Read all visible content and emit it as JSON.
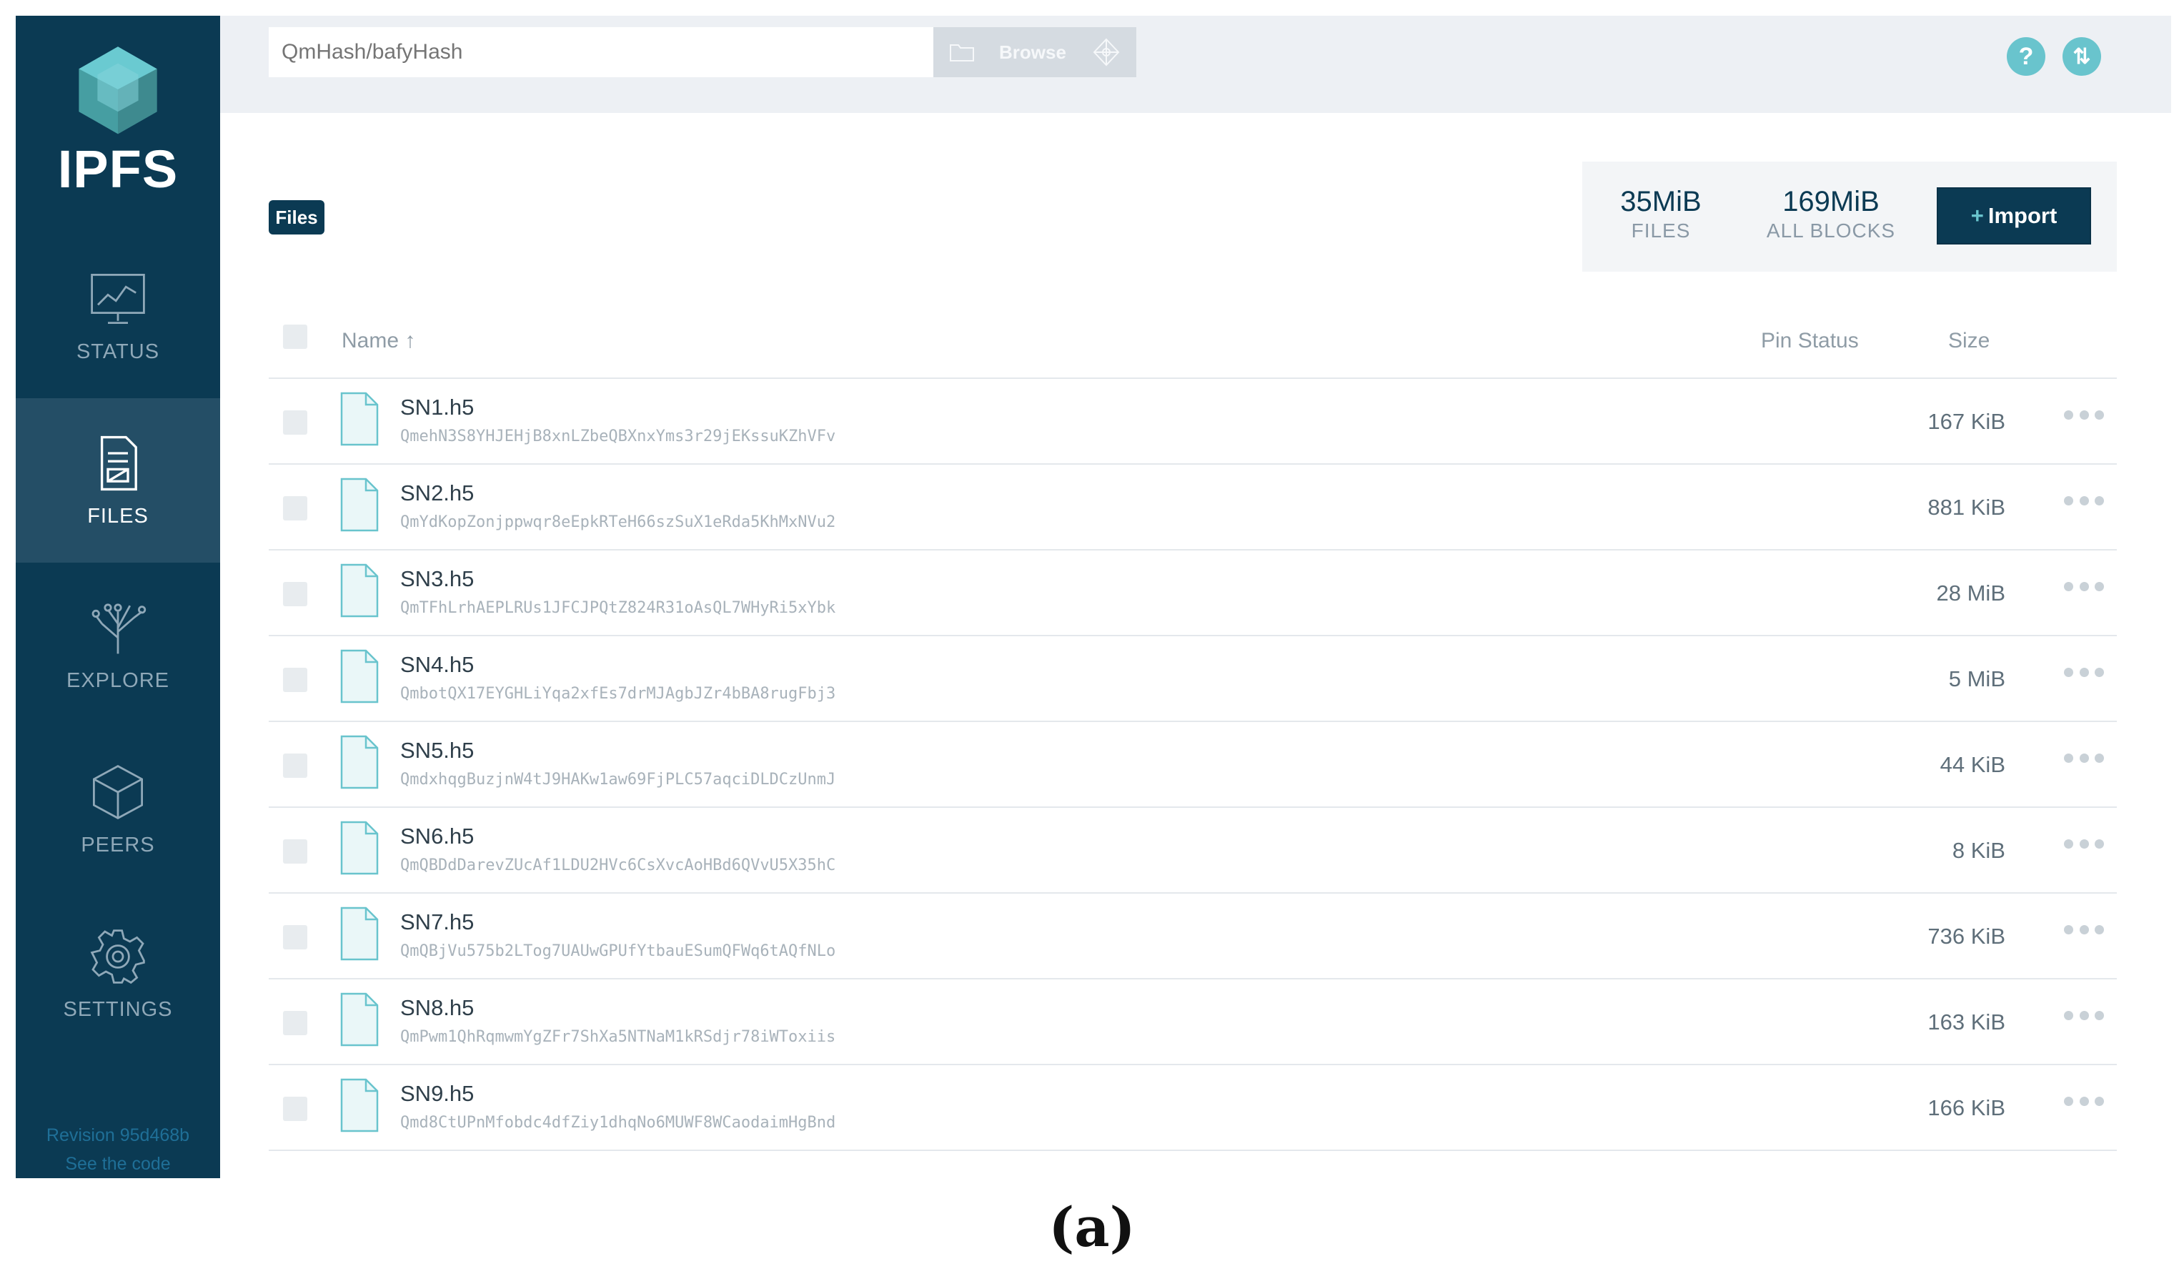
{
  "sidebar": {
    "brand": "IPFS",
    "items": [
      {
        "label": "STATUS",
        "icon": "status-chart-icon",
        "active": false
      },
      {
        "label": "FILES",
        "icon": "files-icon",
        "active": true
      },
      {
        "label": "EXPLORE",
        "icon": "explore-tree-icon",
        "active": false
      },
      {
        "label": "PEERS",
        "icon": "peers-cube-icon",
        "active": false
      },
      {
        "label": "SETTINGS",
        "icon": "gear-icon",
        "active": false
      }
    ],
    "revision": "Revision 95d468b",
    "see_code": "See the code"
  },
  "topbar": {
    "search_placeholder": "QmHash/bafyHash",
    "browse_label": "Browse",
    "help_icon": "?",
    "sync_icon": "⇅"
  },
  "header": {
    "files_tag": "Files",
    "stats": {
      "files_value": "35MiB",
      "files_caption": "FILES",
      "blocks_value": "169MiB",
      "blocks_caption": "ALL BLOCKS"
    },
    "import_plus": "+",
    "import_label": "Import"
  },
  "table": {
    "columns": {
      "name": "Name ↑",
      "pin": "Pin Status",
      "size": "Size"
    },
    "rows": [
      {
        "name": "SN1.h5",
        "hash": "QmehN3S8YHJEHjB8xnLZbeQBXnxYms3r29jEKssuKZhVFv",
        "size": "167 KiB"
      },
      {
        "name": "SN2.h5",
        "hash": "QmYdKopZonjppwqr8eEpkRTeH66szSuX1eRda5KhMxNVu2",
        "size": "881 KiB"
      },
      {
        "name": "SN3.h5",
        "hash": "QmTFhLrhAEPLRUs1JFCJPQtZ824R31oAsQL7WHyRi5xYbk",
        "size": "28 MiB"
      },
      {
        "name": "SN4.h5",
        "hash": "QmbotQX17EYGHLiYqa2xfEs7drMJAgbJZr4bBA8rugFbj3",
        "size": "5 MiB"
      },
      {
        "name": "SN5.h5",
        "hash": "QmdxhqgBuzjnW4tJ9HAKw1aw69FjPLC57aqciDLDCzUnmJ",
        "size": "44 KiB"
      },
      {
        "name": "SN6.h5",
        "hash": "QmQBDdDarevZUcAf1LDU2HVc6CsXvcAoHBd6QVvU5X35hC",
        "size": "8 KiB"
      },
      {
        "name": "SN7.h5",
        "hash": "QmQBjVu575b2LTog7UAUwGPUfYtbauESumQFWq6tAQfNLo",
        "size": "736 KiB"
      },
      {
        "name": "SN8.h5",
        "hash": "QmPwm1QhRqmwmYgZFr7ShXa5NTNaM1kRSdjr78iWToxiis",
        "size": "163 KiB"
      },
      {
        "name": "SN9.h5",
        "hash": "Qmd8CtUPnMfobdc4dfZiy1dhqNo6MUWF8WCaodaimHgBnd",
        "size": "166 KiB"
      }
    ]
  },
  "caption": "(a)",
  "colors": {
    "sidebar": "#0b3a53",
    "sidebar_active": "#244e66",
    "accent": "#69c4cd",
    "topbar": "#edf0f4"
  }
}
